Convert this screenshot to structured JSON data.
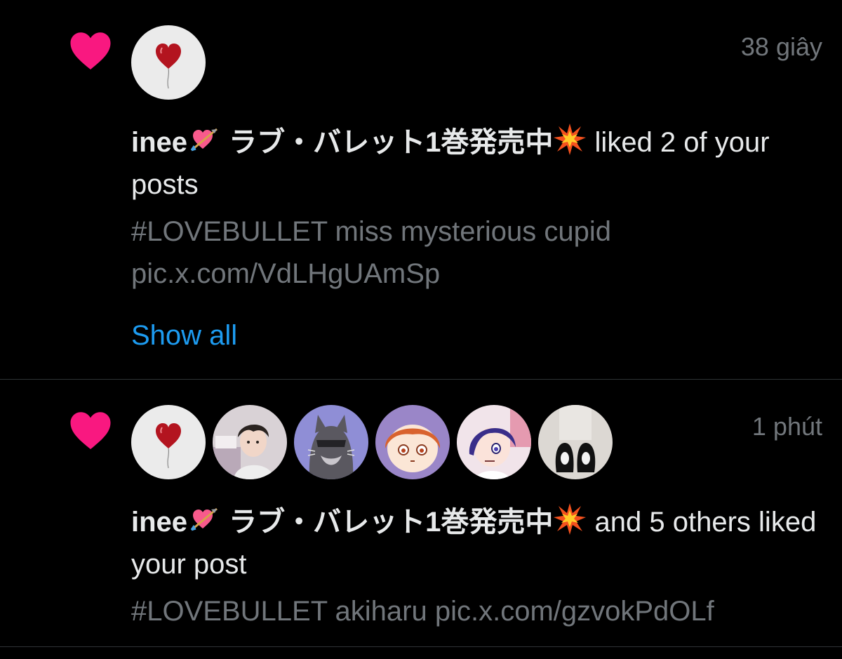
{
  "colors": {
    "background": "#000000",
    "heart": "#f91880",
    "primary_text": "#e7e9ea",
    "secondary_text": "#71767b",
    "link": "#1d9bf0",
    "divider": "#2f3336"
  },
  "notifications": [
    {
      "icon": "heart-icon",
      "timestamp": "38 giây",
      "user_name": "inee",
      "user_name_jp": "ラブ・バレット1巻発売中",
      "action": "liked 2 of your posts",
      "post_preview": "#LOVEBULLET miss mysterious cupid pic.x.com/VdLHgUAmSp",
      "show_all": "Show all",
      "avatars": [
        "heart-balloon-avatar"
      ]
    },
    {
      "icon": "heart-icon",
      "timestamp": "1 phút",
      "user_name": "inee",
      "user_name_jp": "ラブ・バレット1巻発売中",
      "action": "and 5 others liked your post",
      "post_preview": "#LOVEBULLET  akiharu pic.x.com/gzvokPdOLf",
      "avatars": [
        "heart-balloon-avatar",
        "dark-haired-boy-avatar",
        "gray-cat-avatar",
        "orange-haired-girl-avatar",
        "blue-haired-girl-avatar",
        "black-shoes-avatar"
      ]
    }
  ]
}
